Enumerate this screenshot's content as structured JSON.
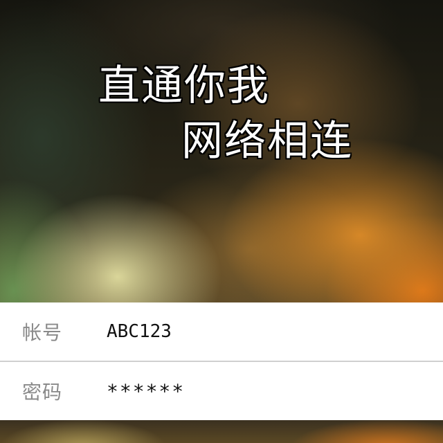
{
  "slogan": {
    "line1": "直通你我",
    "line2": "网络相连"
  },
  "login_form": {
    "account": {
      "label": "帐号",
      "value": "ABC123"
    },
    "password": {
      "label": "密码",
      "value": "******"
    }
  },
  "colors": {
    "form_background": "#ffffff",
    "label_text": "#8a8a8a",
    "value_text": "#111111",
    "divider": "#d0d0d0"
  }
}
